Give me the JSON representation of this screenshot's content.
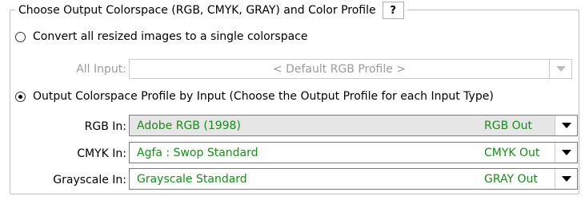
{
  "group": {
    "title": "Choose Output Colorspace (RGB, CMYK, GRAY) and Color Profile",
    "help_label": "?"
  },
  "options": {
    "single": {
      "label": "Convert all resized images to a single colorspace",
      "checked": false,
      "all_input_label": "All Input:",
      "all_input_value": "< Default RGB Profile >"
    },
    "by_input": {
      "label": "Output Colorspace Profile by Input  (Choose the Output Profile for each Input Type)",
      "checked": true
    }
  },
  "rows": [
    {
      "label": "RGB In:",
      "profile": "Adobe RGB (1998)",
      "output": "RGB Out"
    },
    {
      "label": "CMYK In:",
      "profile": "Agfa : Swop Standard",
      "output": "CMYK Out"
    },
    {
      "label": "Grayscale In:",
      "profile": "Grayscale Standard",
      "output": "GRAY Out"
    }
  ],
  "colors": {
    "profile_text": "#1a8a1a",
    "disabled_text": "#9b9b9b"
  }
}
